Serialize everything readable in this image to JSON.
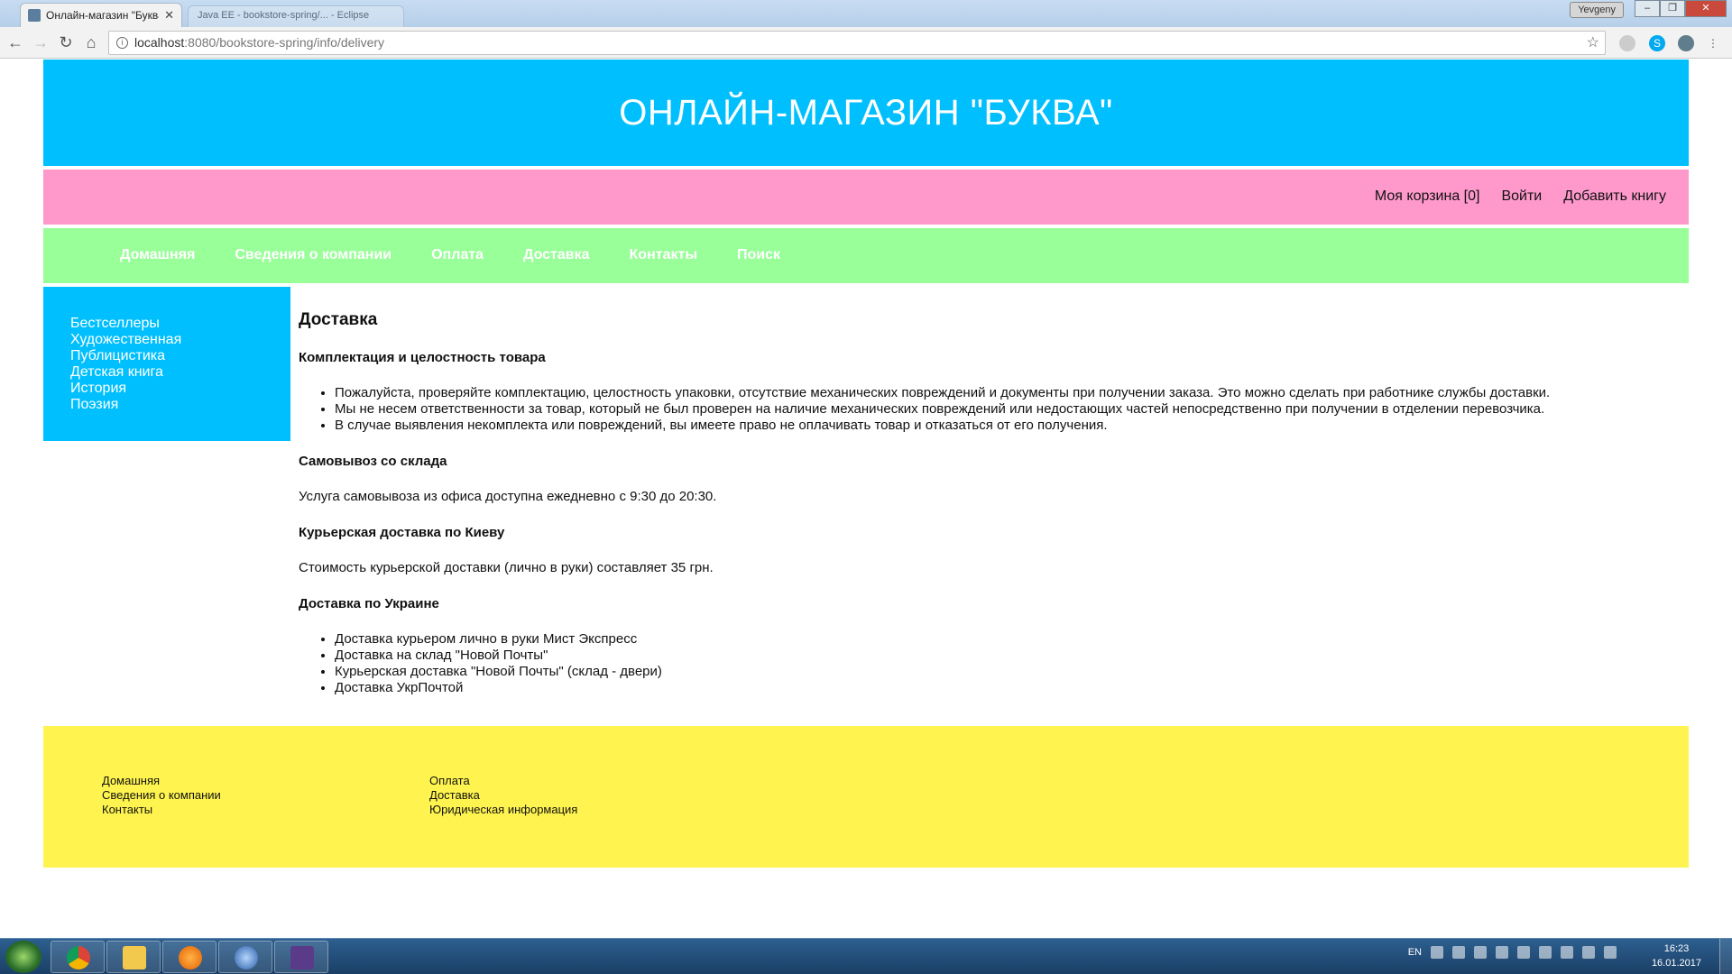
{
  "browser": {
    "active_tab_title": "Онлайн-магазин \"Буква\"",
    "inactive_tab_title": "Java EE - bookstore-spring/... - Eclipse",
    "user_name": "Yevgeny",
    "url_host": "localhost",
    "url_rest": ":8080/bookstore-spring/info/delivery",
    "icons": [
      "back-icon",
      "forward-icon",
      "reload-icon",
      "home-icon",
      "info-icon",
      "star-icon",
      "skype-icon",
      "menu-icon"
    ]
  },
  "site": {
    "title": "ОНЛАЙН-МАГАЗИН \"БУКВА\"",
    "user_links": {
      "cart": "Моя корзина [0]",
      "login": "Войти",
      "add_book": "Добавить книгу"
    },
    "nav": [
      "Домашняя",
      "Сведения о компании",
      "Оплата",
      "Доставка",
      "Контакты",
      "Поиск"
    ],
    "categories": [
      "Бестселлеры",
      "Художественная",
      "Публицистика",
      "Детская книга",
      "История",
      "Поэзия"
    ],
    "colors": {
      "header": "#00bfff",
      "userbar": "#ff99cc",
      "navbar": "#99ff99",
      "sidebar": "#00bfff",
      "footer": "#fff44f"
    }
  },
  "content": {
    "heading": "Доставка",
    "s1_title": "Комплектация и целостность товара",
    "s1_items": [
      "Пожалуйста, проверяйте комплектацию, целостность упаковки, отсутствие механических повреждений и документы при получении заказа. Это можно сделать при работнике службы доставки.",
      "Мы не несем ответственности за товар, который не был проверен на наличие механических повреждений или недостающих частей непосредственно при получении в отделении перевозчика.",
      "В случае выявления некомплекта или повреждений, вы имеете право не оплачивать товар и отказаться от его получения."
    ],
    "s2_title": "Самовывоз со склада",
    "s2_text": "Услуга самовывоза из офиса доступна ежедневно с 9:30 до 20:30.",
    "s3_title": "Курьерская доставка по Киеву",
    "s3_text": "Стоимость курьерской доставки (лично в руки) составляет 35 грн.",
    "s4_title": "Доставка по Украине",
    "s4_items": [
      "Доставка курьером лично в руки Мист Экспресс",
      "Доставка на склад \"Новой Почты\"",
      "Курьерская доставка \"Новой Почты\" (склад - двери)",
      "Доставка УкрПочтой"
    ]
  },
  "footer": {
    "col1": [
      "Домашняя",
      "Сведения о компании",
      "Контакты"
    ],
    "col2": [
      "Оплата",
      "Доставка",
      "Юридическая информация"
    ]
  },
  "taskbar": {
    "lang": "EN",
    "time": "16:23",
    "date": "16.01.2017"
  }
}
